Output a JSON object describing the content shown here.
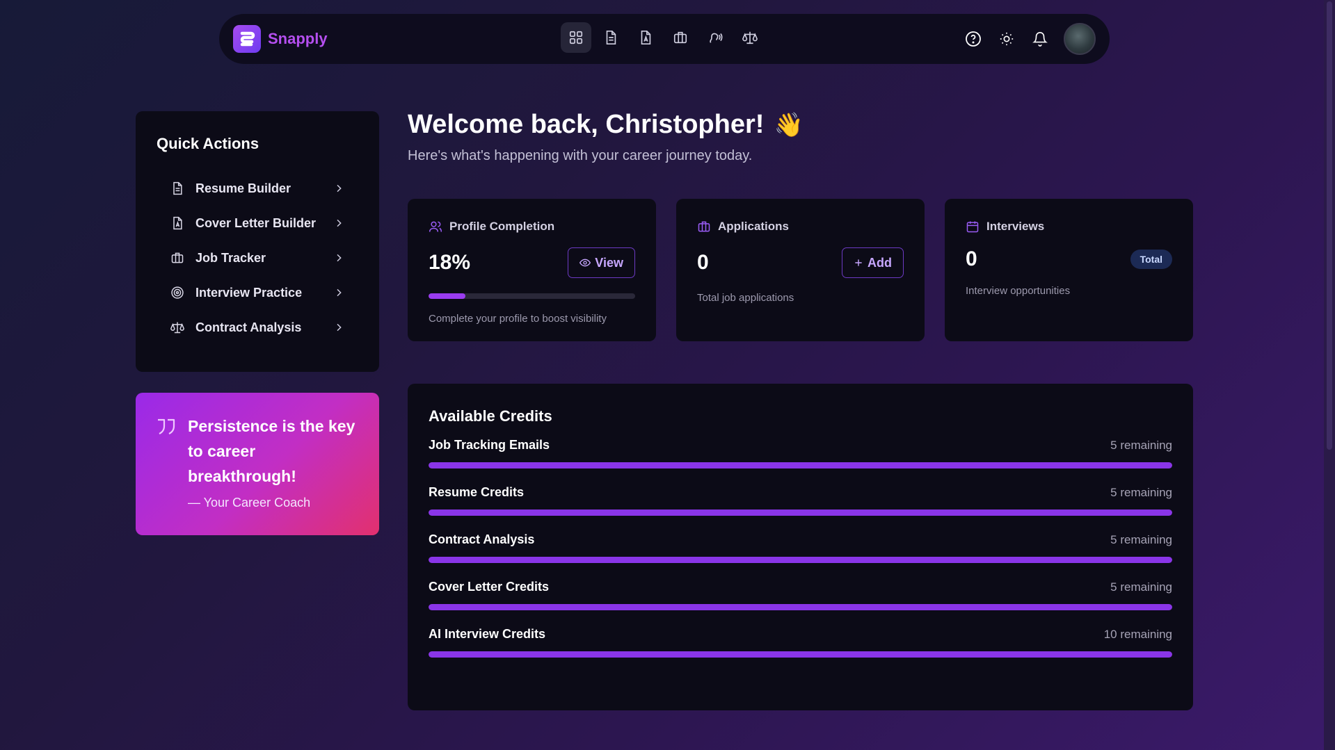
{
  "app": {
    "name": "Snapply"
  },
  "nav": {
    "icons": [
      "dashboard-icon",
      "resume-icon",
      "cover-letter-icon",
      "briefcase-icon",
      "interview-icon",
      "scale-icon"
    ],
    "active_index": 0,
    "right_icons": [
      "help-icon",
      "sun-icon",
      "bell-icon"
    ]
  },
  "quick_actions": {
    "title": "Quick Actions",
    "items": [
      {
        "label": "Resume Builder",
        "icon": "document-icon"
      },
      {
        "label": "Cover Letter Builder",
        "icon": "letter-icon"
      },
      {
        "label": "Job Tracker",
        "icon": "briefcase-icon"
      },
      {
        "label": "Interview Practice",
        "icon": "target-icon"
      },
      {
        "label": "Contract Analysis",
        "icon": "scale-icon"
      }
    ]
  },
  "quote": {
    "text": "Persistence is the key to career breakthrough!",
    "author": "— Your Career Coach"
  },
  "welcome": {
    "title": "Welcome back, Christopher!",
    "emoji": "👋",
    "subtitle": "Here's what's happening with your career journey today."
  },
  "cards": {
    "profile": {
      "title": "Profile Completion",
      "value": "18%",
      "progress": 0.18,
      "button": "View",
      "sub": "Complete your profile to boost visibility"
    },
    "applications": {
      "title": "Applications",
      "value": "0",
      "button": "Add",
      "sub": "Total job applications"
    },
    "interviews": {
      "title": "Interviews",
      "value": "0",
      "badge": "Total",
      "sub": "Interview opportunities"
    }
  },
  "credits": {
    "title": "Available Credits",
    "items": [
      {
        "name": "Job Tracking Emails",
        "remaining": "5 remaining",
        "fill": 1.0
      },
      {
        "name": "Resume Credits",
        "remaining": "5 remaining",
        "fill": 1.0
      },
      {
        "name": "Contract Analysis",
        "remaining": "5 remaining",
        "fill": 1.0
      },
      {
        "name": "Cover Letter Credits",
        "remaining": "5 remaining",
        "fill": 1.0
      },
      {
        "name": "AI Interview Credits",
        "remaining": "10 remaining",
        "fill": 1.0
      }
    ]
  },
  "colors": {
    "accent": "#9a3cf0",
    "brand": "#b54ff0",
    "card_bg": "#0c0b17"
  }
}
